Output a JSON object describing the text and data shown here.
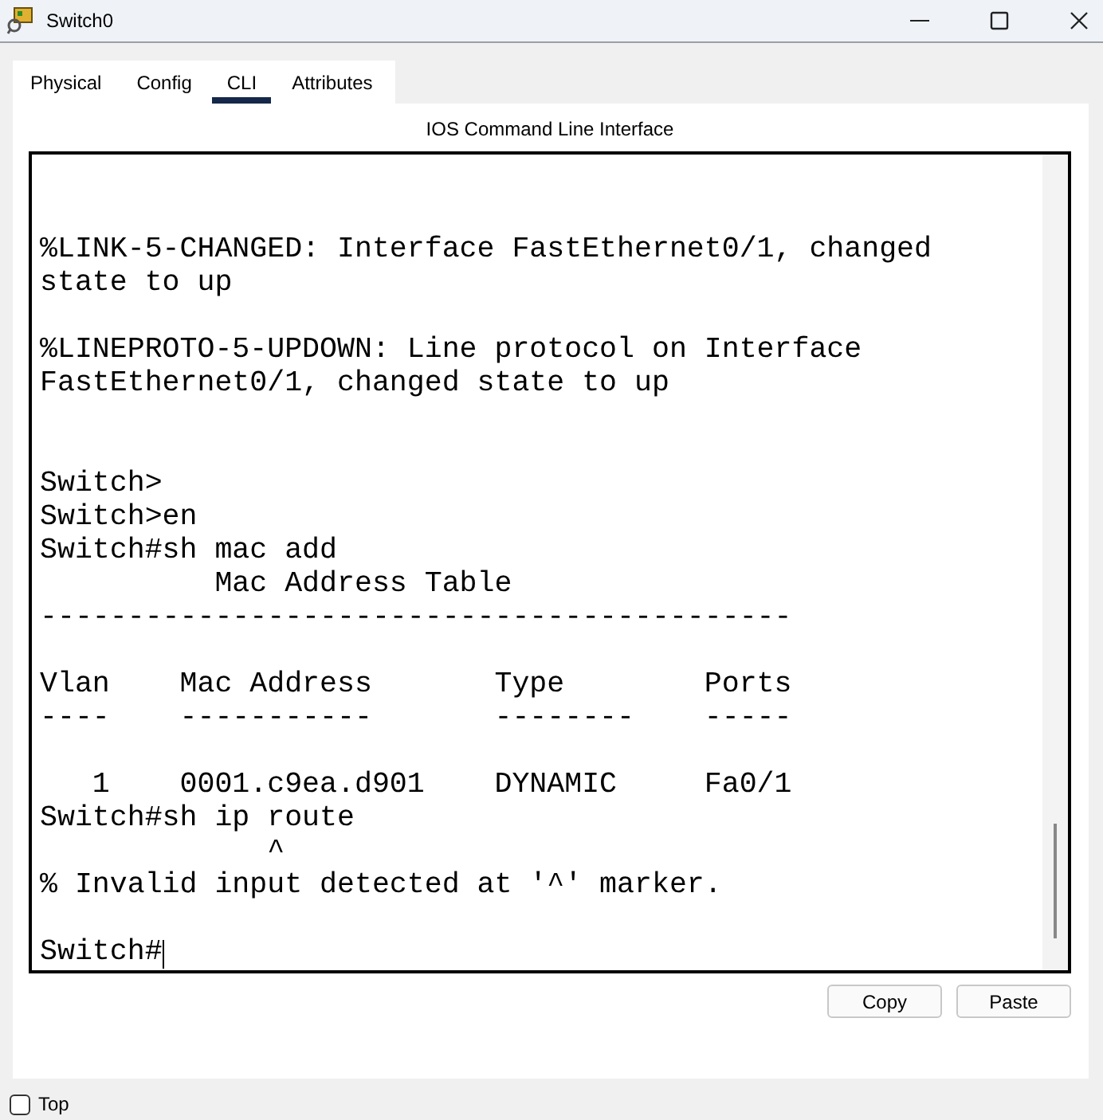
{
  "window": {
    "title": "Switch0"
  },
  "tabs": [
    {
      "label": "Physical",
      "selected": false
    },
    {
      "label": "Config",
      "selected": false
    },
    {
      "label": "CLI",
      "selected": true
    },
    {
      "label": "Attributes",
      "selected": false
    }
  ],
  "panel_title": "IOS Command Line Interface",
  "terminal_output": "%LINK-5-CHANGED: Interface FastEthernet0/1, changed\nstate to up\n\n%LINEPROTO-5-UPDOWN: Line protocol on Interface\nFastEthernet0/1, changed state to up\n\n\nSwitch>\nSwitch>en\nSwitch#sh mac add\n          Mac Address Table\n-------------------------------------------\n\nVlan    Mac Address       Type        Ports\n----    -----------       --------    -----\n\n   1    0001.c9ea.d901    DYNAMIC     Fa0/1\nSwitch#sh ip route\n             ^\n% Invalid input detected at '^' marker.",
  "prompt": "Switch#",
  "buttons": [
    "Copy",
    "Paste"
  ],
  "top_checkbox": {
    "label": "Top",
    "checked": false
  }
}
